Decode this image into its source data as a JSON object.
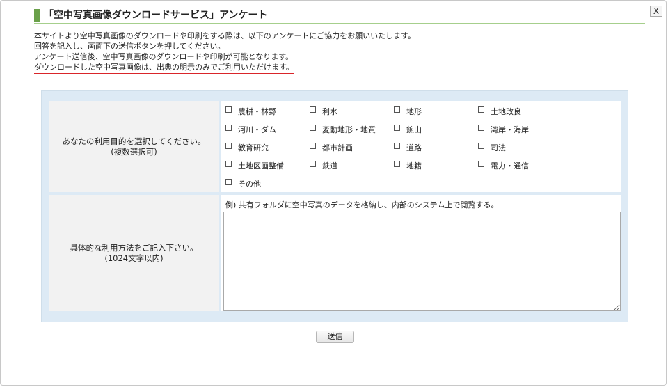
{
  "dialog": {
    "title": "「空中写真画像ダウンロードサービス」アンケート",
    "close_label": "X"
  },
  "intro": {
    "lines": [
      "本サイトより空中写真画像のダウンロードや印刷をする際は、以下のアンケートにご協力をお願いいたします。",
      "回答を記入し、画面下の送信ボタンを押してください。",
      "アンケート送信後、空中写真画像のダウンロードや印刷が可能となります。"
    ],
    "emphasis": "ダウンロードした空中写真画像は、出典の明示のみでご利用いただけます。",
    "emphasis_color": "#d9252a"
  },
  "purpose": {
    "label_line1": "あなたの利用目的を選択してください。",
    "label_line2": "(複数選択可)",
    "options": [
      "農耕・林野",
      "利水",
      "地形",
      "土地改良",
      "河川・ダム",
      "変動地形・地質",
      "鉱山",
      "湾岸・海岸",
      "教育研究",
      "都市計画",
      "道路",
      "司法",
      "土地区画整備",
      "鉄道",
      "地籍",
      "電力・通信",
      "その他"
    ]
  },
  "usage": {
    "label_line1": "具体的な利用方法をご記入下さい。",
    "label_line2": "(1024文字以内)",
    "example": "例) 共有フォルダに空中写真のデータを格納し、内部のシステム上で閲覧する。",
    "value": ""
  },
  "submit_label": "送信",
  "colors": {
    "accent": "#6aa04a",
    "panel_bg": "#ddeaf5",
    "label_bg": "#f2f2f2"
  }
}
